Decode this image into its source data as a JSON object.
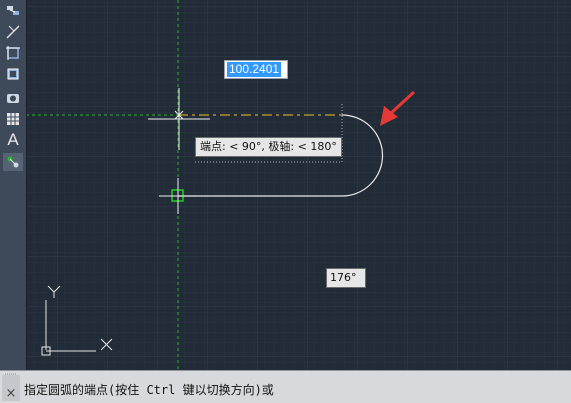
{
  "toolbar": {
    "tools": [
      {
        "icon": "polyline-icon",
        "selected": false
      },
      {
        "icon": "line-icon",
        "selected": false
      },
      {
        "icon": "rectangle-icon",
        "selected": false
      },
      {
        "icon": "block-icon",
        "selected": false
      },
      {
        "icon": "hatch-icon",
        "selected": false
      },
      {
        "icon": "table-icon",
        "selected": false
      },
      {
        "icon": "text-icon",
        "selected": false
      },
      {
        "icon": "point-icon",
        "selected": true
      }
    ],
    "text_tool_label": "A"
  },
  "dynamic_input": {
    "value": "100.2401"
  },
  "tooltips": {
    "polar": "端点: < 90°,  极轴: < 180°",
    "angle": "176°"
  },
  "ucs": {
    "x_label": "X",
    "y_label": "Y"
  },
  "command_line": {
    "prompt": "指定圆弧的端点(按住 Ctrl 键以切换方向)或",
    "close_label": "×"
  },
  "colors": {
    "background": "#222b38",
    "crosshair": "#f2f2f2",
    "tracking_green": "#22bb22",
    "tracking_yellow": "#c9a227",
    "arrow": "#e53935",
    "selection": "#3399ff"
  }
}
